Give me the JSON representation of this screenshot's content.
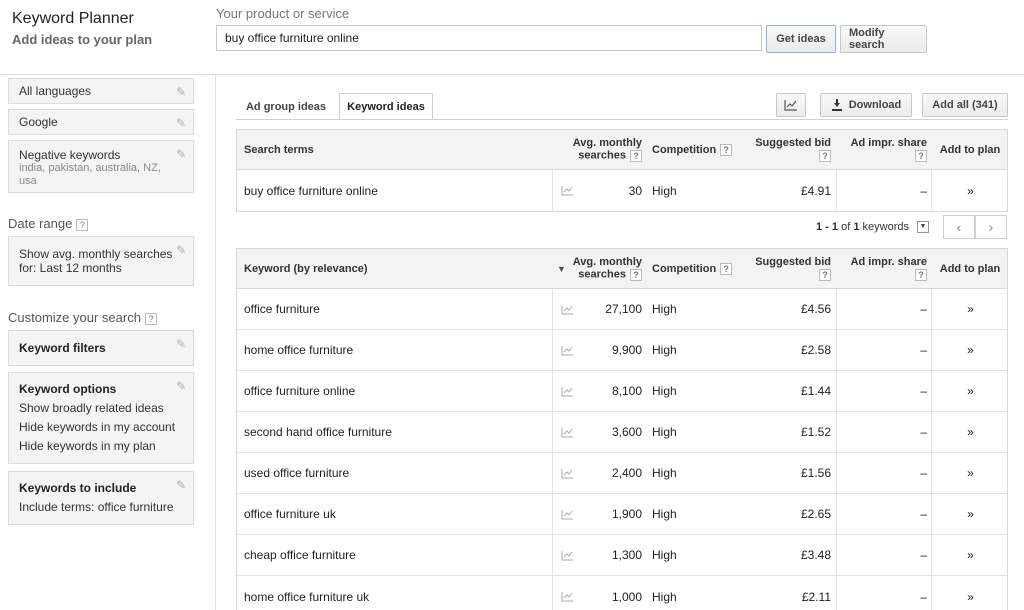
{
  "header": {
    "app_title": "Keyword Planner",
    "app_subtitle": "Add ideas to your plan",
    "product_label": "Your product or service",
    "product_value": "buy office furniture online",
    "get_ideas_label": "Get ideas",
    "modify_search_label": "Modify search"
  },
  "sidebar": {
    "languages": "All languages",
    "network": "Google",
    "negative_title": "Negative keywords",
    "negative_value": "india, pakistan, australia, NZ, usa",
    "date_range_heading": "Date range",
    "date_range_line1": "Show avg. monthly searches",
    "date_range_line2": "for: Last 12 months",
    "customize_heading": "Customize your search",
    "keyword_filters": "Keyword filters",
    "keyword_options_title": "Keyword options",
    "keyword_options": [
      "Show broadly related ideas",
      "Hide keywords in my account",
      "Hide keywords in my plan"
    ],
    "include_title": "Keywords to include",
    "include_value": "Include terms: office furniture",
    "help_mark": "?"
  },
  "tabs": {
    "ad_group_ideas": "Ad group ideas",
    "keyword_ideas": "Keyword ideas"
  },
  "toolbar": {
    "download_label": "Download",
    "add_all_label": "Add all (341)"
  },
  "search_table": {
    "headers": {
      "term": "Search terms",
      "avg1": "Avg. monthly",
      "avg2": "searches",
      "competition": "Competition",
      "bid": "Suggested bid",
      "impr": "Ad impr. share",
      "add": "Add to plan"
    },
    "row": {
      "term": "buy office furniture online",
      "avg": "30",
      "competition": "High",
      "bid": "£4.91",
      "impr": "–"
    }
  },
  "pager": {
    "range": "1 - 1",
    "of_text": "of",
    "count": "1",
    "suffix": "keywords"
  },
  "ideas_table": {
    "headers": {
      "keyword": "Keyword (by relevance)",
      "avg1": "Avg. monthly",
      "avg2": "searches",
      "competition": "Competition",
      "bid": "Suggested bid",
      "impr": "Ad impr. share",
      "add": "Add to plan"
    },
    "rows": [
      {
        "keyword": "office furniture",
        "avg": "27,100",
        "competition": "High",
        "bid": "£4.56",
        "impr": "–"
      },
      {
        "keyword": "home office furniture",
        "avg": "9,900",
        "competition": "High",
        "bid": "£2.58",
        "impr": "–"
      },
      {
        "keyword": "office furniture online",
        "avg": "8,100",
        "competition": "High",
        "bid": "£1.44",
        "impr": "–"
      },
      {
        "keyword": "second hand office furniture",
        "avg": "3,600",
        "competition": "High",
        "bid": "£1.52",
        "impr": "–"
      },
      {
        "keyword": "used office furniture",
        "avg": "2,400",
        "competition": "High",
        "bid": "£1.56",
        "impr": "–"
      },
      {
        "keyword": "office furniture uk",
        "avg": "1,900",
        "competition": "High",
        "bid": "£2.65",
        "impr": "–"
      },
      {
        "keyword": "cheap office furniture",
        "avg": "1,300",
        "competition": "High",
        "bid": "£3.48",
        "impr": "–"
      },
      {
        "keyword": "home office furniture uk",
        "avg": "1,000",
        "competition": "High",
        "bid": "£2.11",
        "impr": "–"
      }
    ]
  }
}
